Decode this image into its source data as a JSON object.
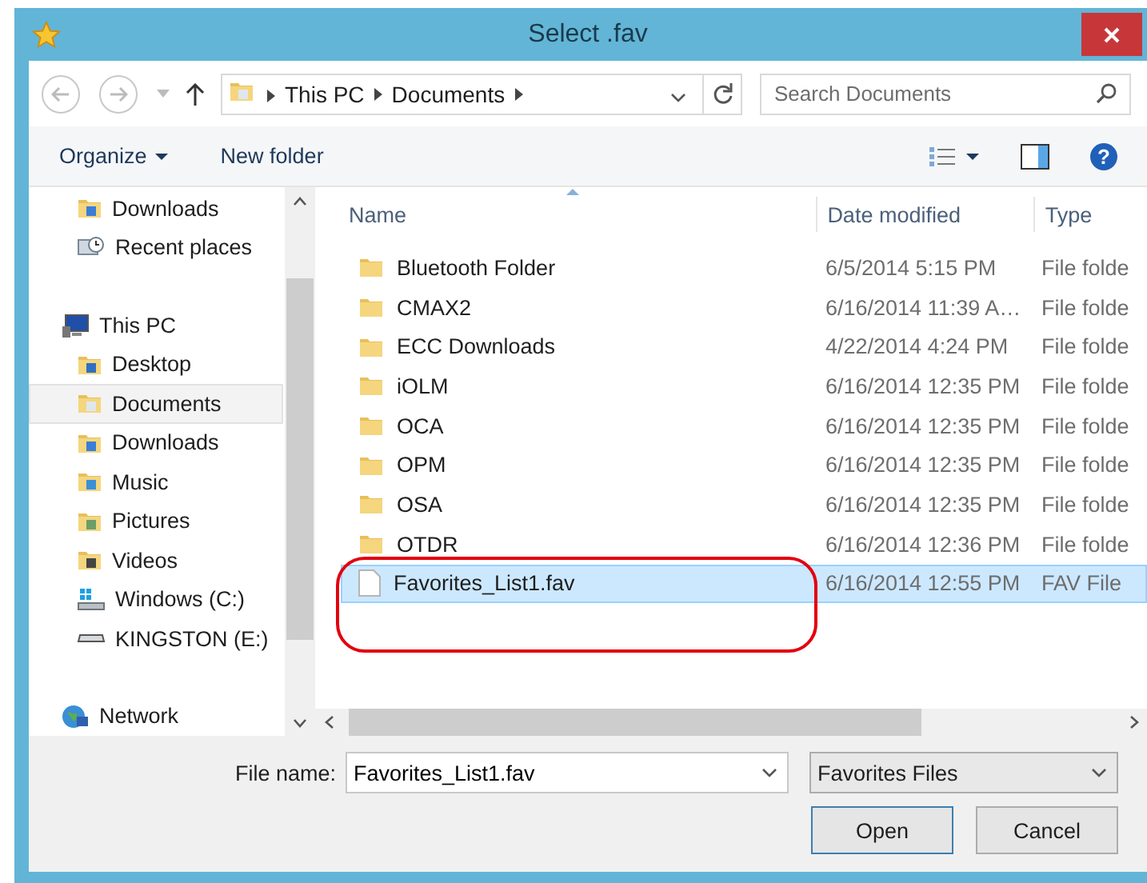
{
  "window": {
    "title": "Select .fav"
  },
  "address_bar": {
    "path": [
      "This PC",
      "Documents"
    ],
    "search_placeholder": "Search Documents"
  },
  "toolbar": {
    "organize": "Organize",
    "new_folder": "New folder",
    "help": "?"
  },
  "nav_pane": {
    "groups": [
      {
        "items": [
          {
            "label": "Downloads",
            "kind": "downloads",
            "selected": false
          },
          {
            "label": "Recent places",
            "kind": "recent",
            "selected": false
          }
        ]
      },
      {
        "label": "This PC",
        "kind": "pc",
        "items": [
          {
            "label": "Desktop",
            "kind": "desktop",
            "selected": false
          },
          {
            "label": "Documents",
            "kind": "documents",
            "selected": true
          },
          {
            "label": "Downloads",
            "kind": "downloads",
            "selected": false
          },
          {
            "label": "Music",
            "kind": "music",
            "selected": false
          },
          {
            "label": "Pictures",
            "kind": "pictures",
            "selected": false
          },
          {
            "label": "Videos",
            "kind": "videos",
            "selected": false
          },
          {
            "label": "Windows (C:)",
            "kind": "system-drive",
            "selected": false
          },
          {
            "label": "KINGSTON (E:)",
            "kind": "usb-drive",
            "selected": false
          }
        ]
      },
      {
        "label": "Network",
        "kind": "network"
      }
    ]
  },
  "file_list": {
    "columns": [
      "Name",
      "Date modified",
      "Type"
    ],
    "rows": [
      {
        "name": "Bluetooth Folder",
        "date": "6/5/2014 5:15 PM",
        "type": "File folde",
        "kind": "folder",
        "selected": false
      },
      {
        "name": "CMAX2",
        "date": "6/16/2014 11:39 A…",
        "type": "File folde",
        "kind": "folder",
        "selected": false
      },
      {
        "name": "ECC Downloads",
        "date": "4/22/2014 4:24 PM",
        "type": "File folde",
        "kind": "folder",
        "selected": false
      },
      {
        "name": "iOLM",
        "date": "6/16/2014 12:35 PM",
        "type": "File folde",
        "kind": "folder",
        "selected": false
      },
      {
        "name": "OCA",
        "date": "6/16/2014 12:35 PM",
        "type": "File folde",
        "kind": "folder",
        "selected": false
      },
      {
        "name": "OPM",
        "date": "6/16/2014 12:35 PM",
        "type": "File folde",
        "kind": "folder",
        "selected": false
      },
      {
        "name": "OSA",
        "date": "6/16/2014 12:35 PM",
        "type": "File folde",
        "kind": "folder",
        "selected": false
      },
      {
        "name": "OTDR",
        "date": "6/16/2014 12:36 PM",
        "type": "File folde",
        "kind": "folder",
        "selected": false
      },
      {
        "name": "Favorites_List1.fav",
        "date": "6/16/2014 12:55 PM",
        "type": "FAV File",
        "kind": "file",
        "selected": true
      }
    ]
  },
  "footer": {
    "file_name_label": "File name:",
    "file_name": "Favorites_List1.fav",
    "file_type": "Favorites Files",
    "buttons": [
      {
        "label": "Open",
        "kind": "default"
      },
      {
        "label": "Cancel",
        "kind": "normal"
      }
    ]
  }
}
